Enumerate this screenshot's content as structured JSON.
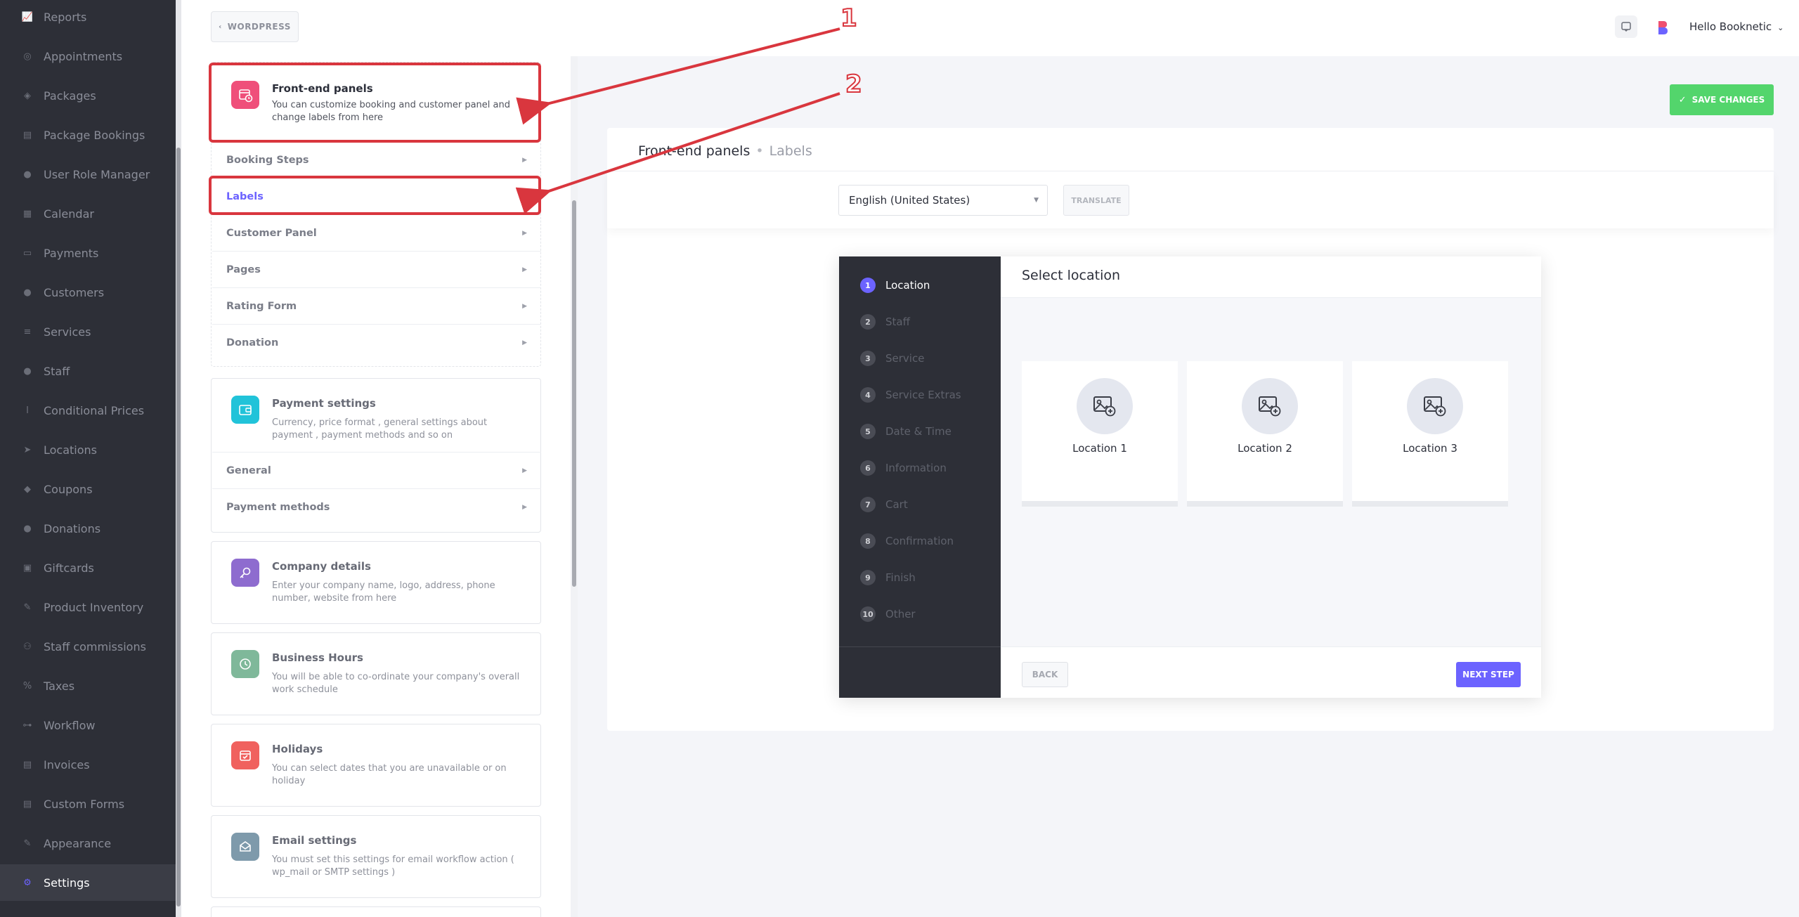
{
  "sidebar": {
    "items": [
      {
        "label": "Reports",
        "icon": "chart-icon"
      },
      {
        "label": "Appointments",
        "icon": "appointments-icon"
      },
      {
        "label": "Packages",
        "icon": "packages-icon"
      },
      {
        "label": "Package Bookings",
        "icon": "package-bookings-icon"
      },
      {
        "label": "User Role Manager",
        "icon": "user-role-icon"
      },
      {
        "label": "Calendar",
        "icon": "calendar-icon"
      },
      {
        "label": "Payments",
        "icon": "payments-icon"
      },
      {
        "label": "Customers",
        "icon": "customers-icon"
      },
      {
        "label": "Services",
        "icon": "services-icon"
      },
      {
        "label": "Staff",
        "icon": "staff-icon"
      },
      {
        "label": "Conditional Prices",
        "icon": "conditional-prices-icon"
      },
      {
        "label": "Locations",
        "icon": "locations-icon"
      },
      {
        "label": "Coupons",
        "icon": "coupons-icon"
      },
      {
        "label": "Donations",
        "icon": "donations-icon"
      },
      {
        "label": "Giftcards",
        "icon": "giftcards-icon"
      },
      {
        "label": "Product Inventory",
        "icon": "product-inventory-icon"
      },
      {
        "label": "Staff commissions",
        "icon": "staff-commissions-icon"
      },
      {
        "label": "Taxes",
        "icon": "taxes-icon"
      },
      {
        "label": "Workflow",
        "icon": "workflow-icon"
      },
      {
        "label": "Invoices",
        "icon": "invoices-icon"
      },
      {
        "label": "Custom Forms",
        "icon": "custom-forms-icon"
      },
      {
        "label": "Appearance",
        "icon": "appearance-icon"
      },
      {
        "label": "Settings",
        "icon": "gear-icon",
        "active": true
      }
    ]
  },
  "topbar": {
    "wordpress_label": "WORDPRESS",
    "user_greeting": "Hello Booknetic"
  },
  "settings_panel": {
    "frontend": {
      "title": "Front-end panels",
      "description": "You can customize booking and customer panel and change labels from here",
      "items": [
        "Booking Steps",
        "Labels",
        "Customer Panel",
        "Pages",
        "Rating Form",
        "Donation"
      ]
    },
    "payment": {
      "title": "Payment settings",
      "description": "Currency, price format , general settings about payment , payment methods and so on",
      "items": [
        "General",
        "Payment methods"
      ]
    },
    "company": {
      "title": "Company details",
      "description": "Enter your company name, logo, address, phone number, website from here"
    },
    "hours": {
      "title": "Business Hours",
      "description": "You will be able to co-ordinate your company's overall work schedule"
    },
    "holidays": {
      "title": "Holidays",
      "description": "You can select dates that you are unavailable or on holiday"
    },
    "email": {
      "title": "Email settings",
      "description": "You must set this settings for email workflow action ( wp_mail or SMTP settings )"
    }
  },
  "main": {
    "save_label": "SAVE CHANGES",
    "breadcrumb_main": "Front-end panels",
    "breadcrumb_sub": "Labels",
    "language": "English (United States)",
    "translate_label": "TRANSLATE"
  },
  "booking_panel": {
    "steps": [
      {
        "num": "1",
        "label": "Location"
      },
      {
        "num": "2",
        "label": "Staff"
      },
      {
        "num": "3",
        "label": "Service"
      },
      {
        "num": "4",
        "label": "Service Extras"
      },
      {
        "num": "5",
        "label": "Date & Time"
      },
      {
        "num": "6",
        "label": "Information"
      },
      {
        "num": "7",
        "label": "Cart"
      },
      {
        "num": "8",
        "label": "Confirmation"
      },
      {
        "num": "9",
        "label": "Finish"
      },
      {
        "num": "10",
        "label": "Other"
      }
    ],
    "title": "Select location",
    "locations": [
      "Location 1",
      "Location 2",
      "Location 3"
    ],
    "back_label": "BACK",
    "next_label": "NEXT STEP"
  },
  "annotations": {
    "first": "1",
    "second": "2"
  },
  "colors": {
    "accent": "#6c63ff",
    "highlight": "#d9363e",
    "save": "#53d56c",
    "sidebar": "#2d2f37"
  }
}
